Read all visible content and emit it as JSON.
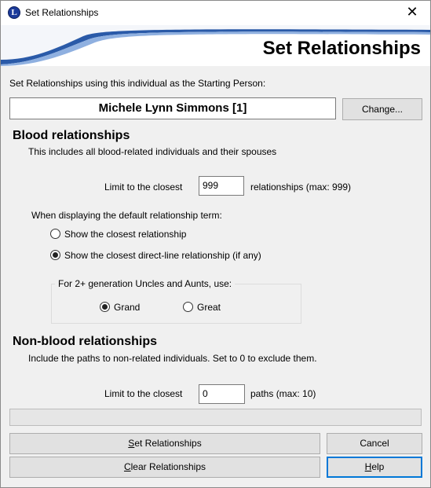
{
  "window": {
    "title": "Set Relationships",
    "app_icon_letter": "L",
    "close_glyph": "✕"
  },
  "banner": {
    "title": "Set Relationships"
  },
  "starting_person": {
    "prompt": "Set Relationships using this individual as the Starting Person:",
    "name": "Michele Lynn Simmons [1]",
    "change_button_label": "Change..."
  },
  "blood": {
    "heading": "Blood relationships",
    "description": "This includes all blood-related individuals and their spouses",
    "limit_prefix": "Limit to the closest",
    "limit_value": "999",
    "limit_suffix": "relationships (max: 999)",
    "term_prompt": "When displaying the default relationship term:",
    "term_options": [
      {
        "label": "Show the closest relationship",
        "selected": false
      },
      {
        "label": "Show the closest direct-line relationship (if any)",
        "selected": true
      }
    ],
    "generation_group": {
      "label": "For 2+ generation Uncles and Aunts, use:",
      "options": [
        {
          "label": "Grand",
          "selected": true
        },
        {
          "label": "Great",
          "selected": false
        }
      ]
    }
  },
  "nonblood": {
    "heading": "Non-blood relationships",
    "description": "Include the paths to non-related individuals.  Set to 0 to exclude them.",
    "limit_prefix": "Limit to the closest",
    "limit_value": "0",
    "limit_suffix": "paths (max: 10)"
  },
  "progress": {
    "value": 0
  },
  "buttons": {
    "set_prefix": "",
    "set_mnemonic": "S",
    "set_rest": "et Relationships",
    "cancel": "Cancel",
    "clear_mnemonic": "C",
    "clear_rest": "lear Relationships",
    "help_mnemonic": "H",
    "help_rest": "elp"
  },
  "colors": {
    "accent_blue": "#0078d7",
    "banner_swoosh": "#2a5aa8"
  }
}
